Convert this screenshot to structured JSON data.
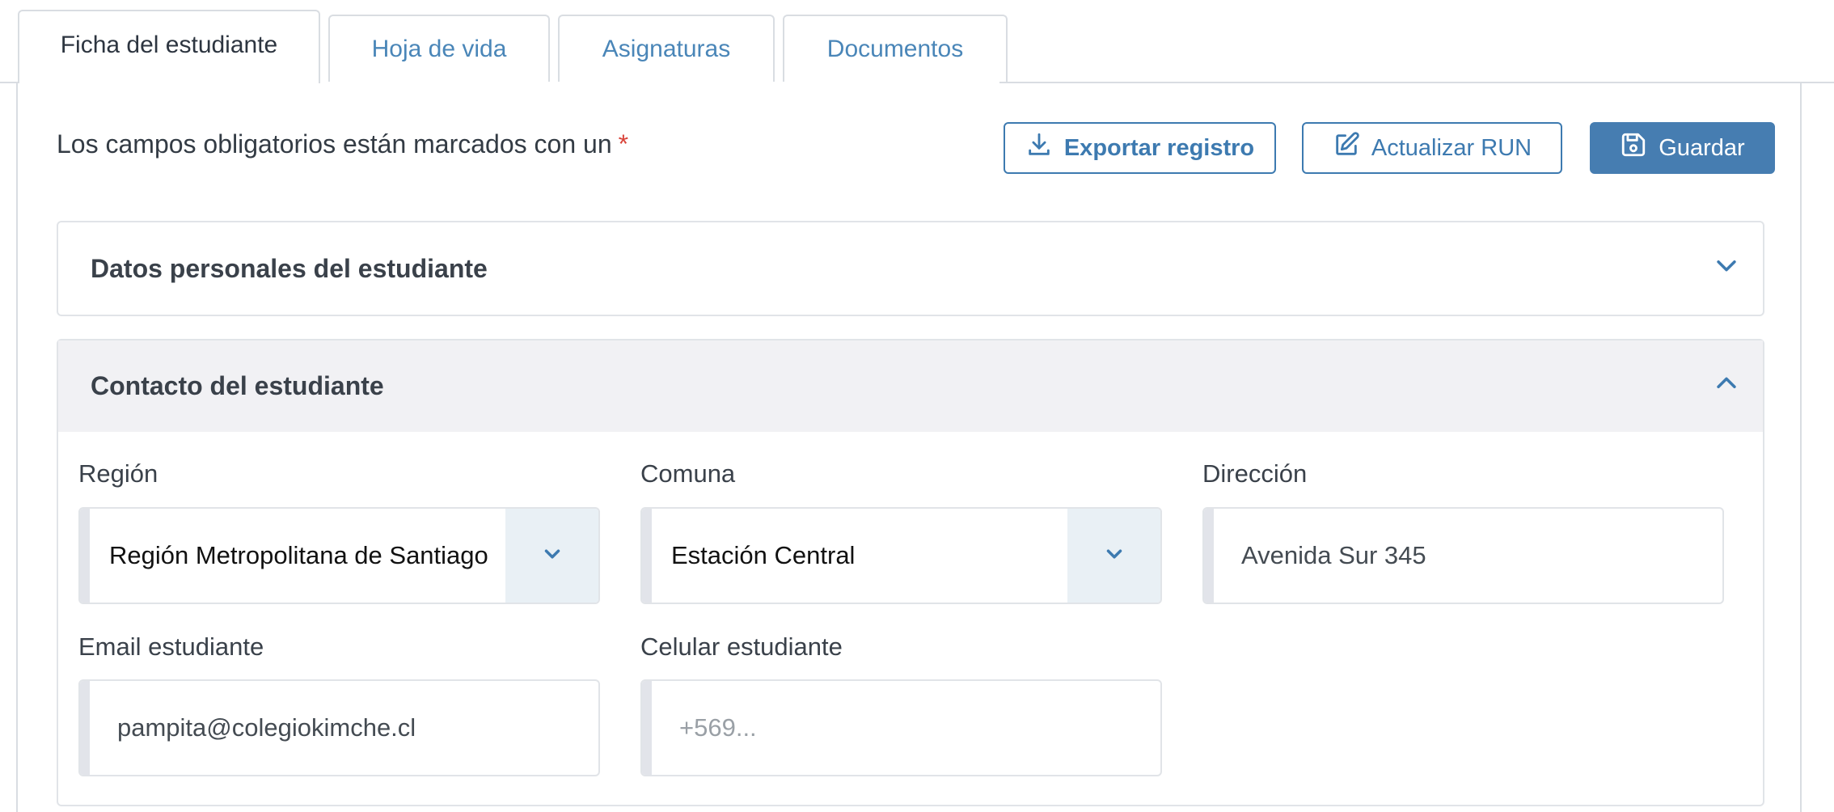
{
  "tabs": [
    {
      "label": "Ficha del estudiante",
      "active": true
    },
    {
      "label": "Hoja de vida",
      "active": false
    },
    {
      "label": "Asignaturas",
      "active": false
    },
    {
      "label": "Documentos",
      "active": false
    }
  ],
  "required_note": {
    "text": "Los campos obligatorios están marcados con un",
    "star": "*"
  },
  "toolbar": {
    "export_label": "Exportar registro",
    "export_icon": "download-icon",
    "update_run_label": "Actualizar RUN",
    "update_run_icon": "edit-icon",
    "save_label": "Guardar",
    "save_icon": "floppy-disk-icon"
  },
  "sections": {
    "personal": {
      "title": "Datos personales del estudiante",
      "expanded": false
    },
    "contact": {
      "title": "Contacto del estudiante",
      "expanded": true
    }
  },
  "contact_form": {
    "region": {
      "label": "Región",
      "value": "Región Metropolitana de Santiago"
    },
    "comuna": {
      "label": "Comuna",
      "value": "Estación Central"
    },
    "direccion": {
      "label": "Dirección",
      "value": "Avenida Sur 345"
    },
    "email": {
      "label": "Email estudiante",
      "value": "pampita@colegiokimche.cl"
    },
    "celular": {
      "label": "Celular estudiante",
      "value": "",
      "placeholder": "+569..."
    }
  },
  "colors": {
    "accent": "#467db1",
    "required": "#d9443a",
    "tab_link": "#4a86b8"
  }
}
